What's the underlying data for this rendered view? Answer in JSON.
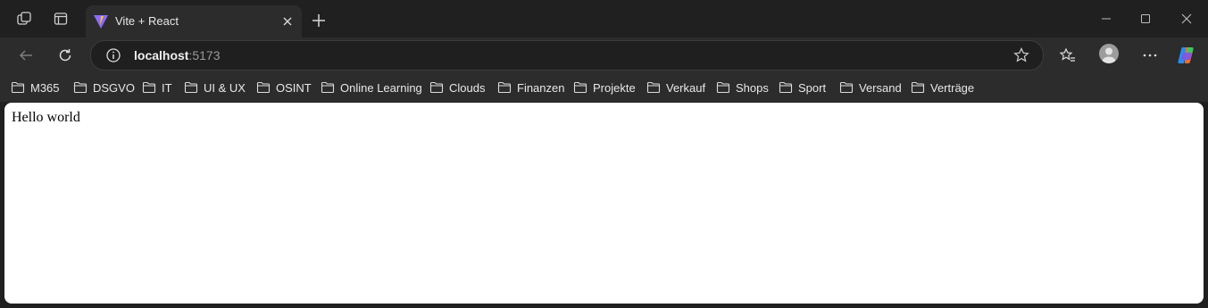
{
  "tab": {
    "title": "Vite + React"
  },
  "address": {
    "host": "localhost",
    "port": ":5173"
  },
  "bookmarks": [
    "M365",
    "DSGVO",
    "IT",
    "UI & UX",
    "OSINT",
    "Online Learning",
    "Clouds",
    "Finanzen",
    "Projekte",
    "Verkauf",
    "Shops",
    "Sport",
    "Versand",
    "Verträge"
  ],
  "page": {
    "text": "Hello world"
  },
  "icons": {
    "workspaces": "workspaces-icon",
    "vertical_tabs": "vertical-tabs-icon",
    "favicon": "vite-logo-icon",
    "close": "close-icon",
    "new_tab": "plus-icon",
    "back": "back-arrow-icon",
    "refresh": "refresh-icon",
    "info": "info-icon",
    "star": "star-icon",
    "favorites": "favorites-icon",
    "profile": "profile-avatar-icon",
    "more": "more-icon",
    "copilot": "copilot-icon",
    "folder": "folder-icon"
  },
  "colors": {
    "frame": "#202020",
    "toolbar": "#2c2c2c",
    "page": "#ffffff"
  }
}
